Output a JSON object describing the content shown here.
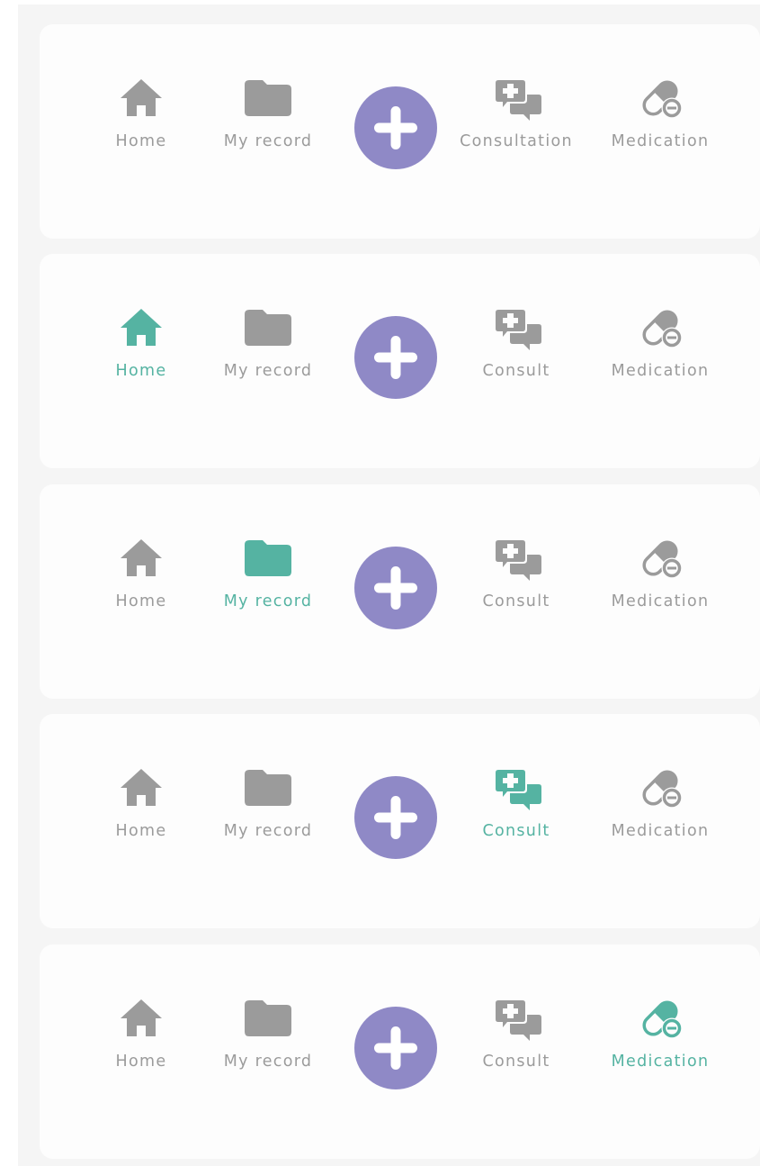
{
  "colors": {
    "active": "#55b3a2",
    "inactive": "#9b9b9b",
    "fab": "#8f89c6",
    "card": "#fdfdfd",
    "background": "#f5f5f5"
  },
  "bars": [
    {
      "active": "none",
      "tabs": [
        {
          "key": "home",
          "label": "Home",
          "icon": "home-icon"
        },
        {
          "key": "record",
          "label": "My record",
          "icon": "folder-icon"
        },
        {
          "key": "consult",
          "label": "Consultation",
          "icon": "consult-chat-icon"
        },
        {
          "key": "medication",
          "label": "Medication",
          "icon": "pill-icon"
        }
      ],
      "fab_icon": "plus-icon"
    },
    {
      "active": "home",
      "tabs": [
        {
          "key": "home",
          "label": "Home",
          "icon": "home-icon"
        },
        {
          "key": "record",
          "label": "My record",
          "icon": "folder-icon"
        },
        {
          "key": "consult",
          "label": "Consult",
          "icon": "consult-chat-icon"
        },
        {
          "key": "medication",
          "label": "Medication",
          "icon": "pill-icon"
        }
      ],
      "fab_icon": "plus-icon"
    },
    {
      "active": "record",
      "tabs": [
        {
          "key": "home",
          "label": "Home",
          "icon": "home-icon"
        },
        {
          "key": "record",
          "label": "My record",
          "icon": "folder-icon"
        },
        {
          "key": "consult",
          "label": "Consult",
          "icon": "consult-chat-icon"
        },
        {
          "key": "medication",
          "label": "Medication",
          "icon": "pill-icon"
        }
      ],
      "fab_icon": "plus-icon"
    },
    {
      "active": "consult",
      "tabs": [
        {
          "key": "home",
          "label": "Home",
          "icon": "home-icon"
        },
        {
          "key": "record",
          "label": "My record",
          "icon": "folder-icon"
        },
        {
          "key": "consult",
          "label": "Consult",
          "icon": "consult-chat-icon"
        },
        {
          "key": "medication",
          "label": "Medication",
          "icon": "pill-icon"
        }
      ],
      "fab_icon": "plus-icon"
    },
    {
      "active": "medication",
      "tabs": [
        {
          "key": "home",
          "label": "Home",
          "icon": "home-icon"
        },
        {
          "key": "record",
          "label": "My record",
          "icon": "folder-icon"
        },
        {
          "key": "consult",
          "label": "Consult",
          "icon": "consult-chat-icon"
        },
        {
          "key": "medication",
          "label": "Medication",
          "icon": "pill-icon"
        }
      ],
      "fab_icon": "plus-icon"
    }
  ]
}
